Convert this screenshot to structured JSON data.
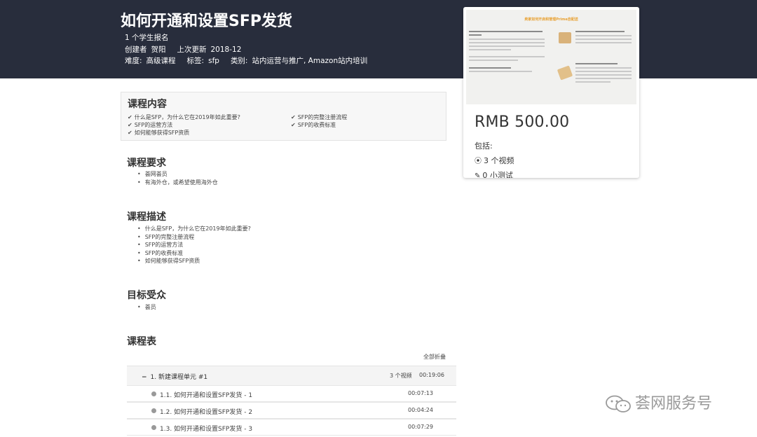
{
  "header": {
    "title": "如何开通和设置SFP发货",
    "enrolled": "1 个学生报名",
    "creator_label": "创建者",
    "creator_name": "贺阳",
    "updated_label": "上次更新",
    "updated_value": "2018-12",
    "difficulty_label": "难度:",
    "difficulty_value": "高级课程",
    "tags_label": "标签:",
    "tags_value": "sfp",
    "category_label": "类别:",
    "category_value": "站内运营与推广, Amazon站内培训"
  },
  "card": {
    "thumbnail_title": "卖家如何开启和管理Prime自配送",
    "price": "RMB 500.00",
    "includes_label": "包括:",
    "includes": [
      {
        "icon": "play-circle-icon",
        "text": "3 个视频"
      },
      {
        "icon": "edit-icon",
        "text": "0 小测试"
      }
    ]
  },
  "course_content": {
    "heading": "课程内容",
    "items": [
      "什么是SFP，为什么它在2019年如此重要?",
      "SFP的完整注册流程",
      "SFP的运营方法",
      "SFP的收费标准",
      "如何能够获得SFP资质"
    ]
  },
  "requirements": {
    "heading": "课程要求",
    "items": [
      "荟网荟员",
      "有海外仓，或希望使用海外仓"
    ]
  },
  "description": {
    "heading": "课程描述",
    "items": [
      "什么是SFP，为什么它在2019年如此重要?",
      "SFP的完整注册流程",
      "SFP的运营方法",
      "SFP的收费标准",
      "如何能够获得SFP资质"
    ]
  },
  "audience": {
    "heading": "目标受众",
    "items": [
      "荟员"
    ]
  },
  "curriculum": {
    "heading": "课程表",
    "collapse_all": "全部折叠",
    "unit": {
      "title": "1. 新建课程单元 #1",
      "count": "3 个视频",
      "duration": "00:19:06"
    },
    "lessons": [
      {
        "title": "1.1. 如何开通和设置SFP发货 - 1",
        "duration": "00:07:13"
      },
      {
        "title": "1.2. 如何开通和设置SFP发货 - 2",
        "duration": "00:04:24"
      },
      {
        "title": "1.3. 如何开通和设置SFP发货 - 3",
        "duration": "00:07:29"
      }
    ]
  },
  "watermark": "荟网服务号",
  "colors": {
    "header_bg": "#282d3c",
    "accent_orange": "#e8a030",
    "text": "#333333"
  }
}
